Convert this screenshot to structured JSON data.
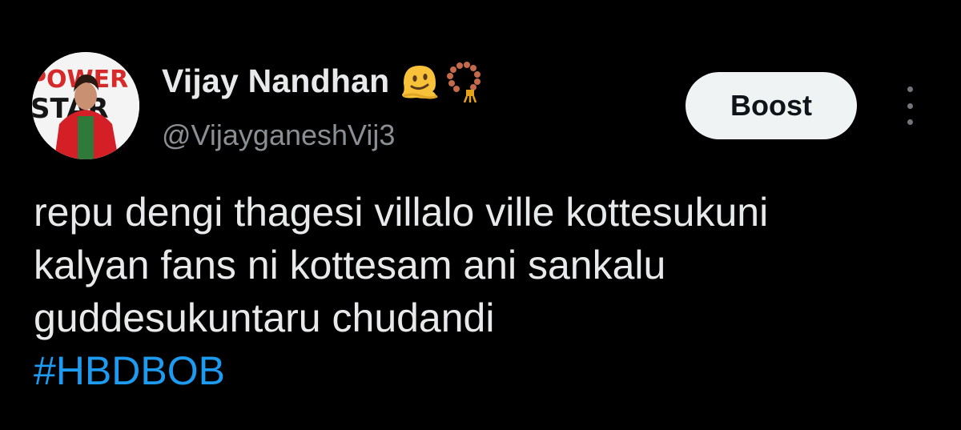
{
  "post": {
    "author": {
      "display_name": "Vijay Nandhan",
      "handle": "@VijayganeshVij3",
      "avatar_text": [
        "POWER",
        "STAR"
      ],
      "name_emojis": [
        "melting-face-emoji",
        "prayer-beads-emoji"
      ]
    },
    "actions": {
      "boost_label": "Boost",
      "more_icon": "vertical-ellipsis-icon"
    },
    "body_lines": [
      "repu dengi thagesi villalo ville kottesukuni",
      "kalyan fans ni kottesam ani sankalu",
      "guddesukuntaru chudandi"
    ],
    "hashtag": "#HBDBOB"
  },
  "colors": {
    "background": "#000000",
    "text_primary": "#e7e9ea",
    "text_secondary": "#8b8f94",
    "link": "#1d9bf0",
    "button_bg": "#eff3f4",
    "button_text": "#0f1419"
  }
}
